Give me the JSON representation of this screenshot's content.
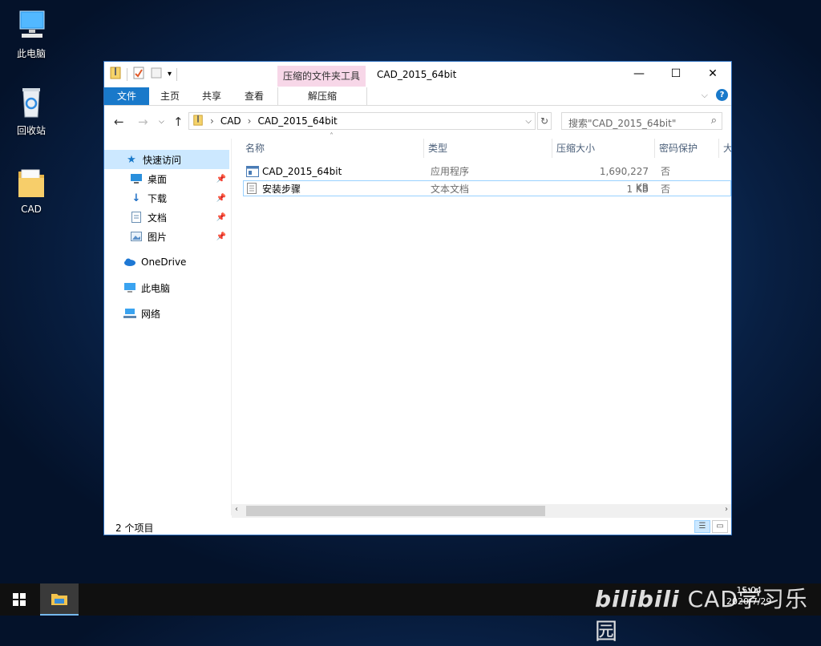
{
  "desktop": {
    "icons": [
      {
        "label": "此电脑"
      },
      {
        "label": "回收站"
      },
      {
        "label": "CAD"
      }
    ]
  },
  "window": {
    "title": "CAD_2015_64bit",
    "context_tab_group": "压缩的文件夹工具",
    "ribbon_tabs": [
      "文件",
      "主页",
      "共享",
      "查看",
      "解压缩"
    ],
    "caption_buttons": {
      "minimize": "—",
      "maximize": "☐",
      "close": "✕"
    }
  },
  "address": {
    "crumbs": [
      "CAD",
      "CAD_2015_64bit"
    ],
    "search_placeholder": "搜索\"CAD_2015_64bit\""
  },
  "nav_pane": {
    "quick_access": "快速访问",
    "items": [
      {
        "label": "桌面",
        "icon": "desktop-icon"
      },
      {
        "label": "下载",
        "icon": "download-icon"
      },
      {
        "label": "文档",
        "icon": "document-icon"
      },
      {
        "label": "图片",
        "icon": "pictures-icon"
      }
    ],
    "onedrive": "OneDrive",
    "this_pc": "此电脑",
    "network": "网络"
  },
  "columns": [
    "名称",
    "类型",
    "压缩大小",
    "密码保护",
    "大"
  ],
  "files": [
    {
      "name": "CAD_2015_64bit",
      "type": "应用程序",
      "size": "1,690,227 KB",
      "protected": "否"
    },
    {
      "name": "安装步骤",
      "type": "文本文档",
      "size": "1 KB",
      "protected": "否"
    }
  ],
  "status": {
    "item_count": "2 个项目"
  },
  "taskbar": {
    "clock_time": "15:04",
    "clock_date": "2020/7/29",
    "watermark": "CAD学习乐园"
  }
}
